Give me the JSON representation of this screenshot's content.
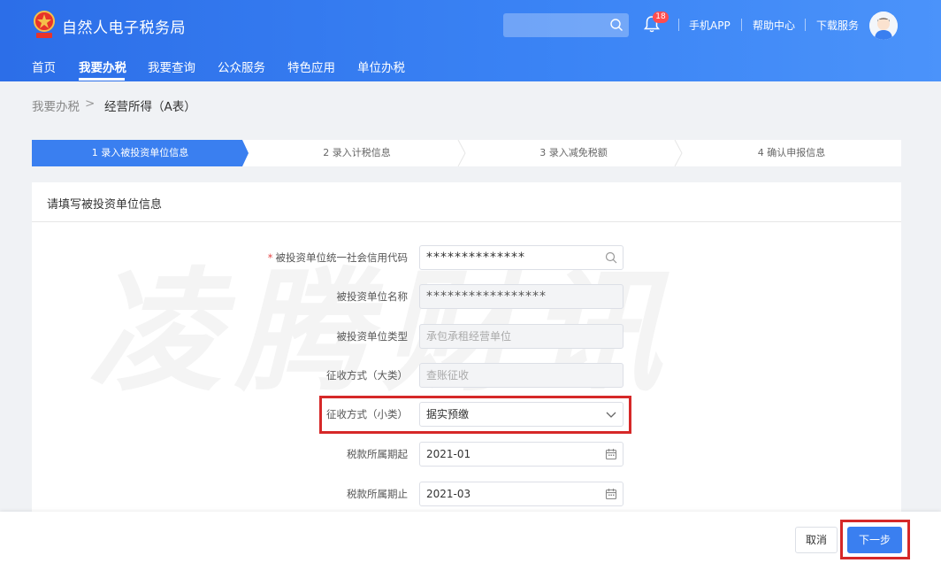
{
  "header": {
    "site_title": "自然人电子税务局",
    "notification_count": "18",
    "links": [
      "手机APP",
      "帮助中心",
      "下载服务"
    ]
  },
  "nav": {
    "items": [
      "首页",
      "我要办税",
      "我要查询",
      "公众服务",
      "特色应用",
      "单位办税"
    ],
    "active": "我要办税"
  },
  "breadcrumb": {
    "parent": "我要办税",
    "separator": ">",
    "current": "经营所得（A表）"
  },
  "steps": [
    {
      "label": "1 录入被投资单位信息",
      "active": true
    },
    {
      "label": "2 录入计税信息",
      "active": false
    },
    {
      "label": "3 录入减免税额",
      "active": false
    },
    {
      "label": "4 确认申报信息",
      "active": false
    }
  ],
  "panel": {
    "title": "请填写被投资单位信息",
    "watermark": "凌腾财讯"
  },
  "form": {
    "required_mark": "*",
    "credit_code": {
      "label": "被投资单位统一社会信用代码",
      "value": "**************"
    },
    "unit_name": {
      "label": "被投资单位名称",
      "value": "*****************"
    },
    "unit_type": {
      "label": "被投资单位类型",
      "value": "承包承租经营单位"
    },
    "collection_major": {
      "label": "征收方式（大类）",
      "value": "查账征收"
    },
    "collection_minor": {
      "label": "征收方式（小类）",
      "value": "据实预缴"
    },
    "period_start": {
      "label": "税款所属期起",
      "value": "2021-01"
    },
    "period_end": {
      "label": "税款所属期止",
      "value": "2021-03"
    }
  },
  "footer": {
    "cancel_label": "取消",
    "next_label": "下一步"
  },
  "colors": {
    "primary": "#3a7ff0",
    "highlight": "#d62828"
  }
}
